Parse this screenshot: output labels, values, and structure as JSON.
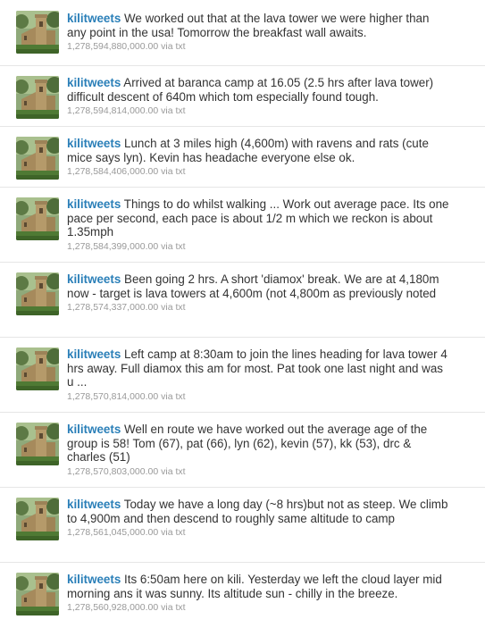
{
  "feed": {
    "tweets": [
      {
        "username": "kilitweets",
        "text": "We worked out that at the lava tower we were higher than any point in the usa! Tomorrow the breakfast wall awaits.",
        "id": "1,278,594,880,000.00",
        "via": "via txt"
      },
      {
        "username": "kilitweets",
        "text": "Arrived at baranca camp at 16.05 (2.5 hrs after lava tower) difficult descent of 640m which tom especially found tough.",
        "id": "1,278,594,814,000.00",
        "via": "via txt"
      },
      {
        "username": "kilitweets",
        "text": "Lunch at 3 miles high (4,600m) with ravens and rats (cute mice says lyn). Kevin has headache everyone else ok.",
        "id": "1,278,584,406,000.00",
        "via": "via txt"
      },
      {
        "username": "kilitweets",
        "text": "Things to do whilst walking ... Work out average pace. Its one pace per second, each pace is about 1/2 m which we reckon is about 1.35mph",
        "id": "1,278,584,399,000.00",
        "via": "via txt"
      },
      {
        "username": "kilitweets",
        "text": "Been going 2 hrs. A short 'diamox' break. We are at 4,180m now - target is lava towers at 4,600m (not 4,800m as previously noted",
        "id": "1,278,574,337,000.00",
        "via": "via txt"
      },
      {
        "username": "kilitweets",
        "text": "Left camp at 8:30am to join the lines heading for lava tower 4 hrs away. Full diamox this am for most. Pat took one last night and was u ...",
        "id": "1,278,570,814,000.00",
        "via": "via txt"
      },
      {
        "username": "kilitweets",
        "text": "Well en route we have worked out the average age of the group is 58! Tom (67), pat (66), lyn (62), kevin (57), kk (53), drc & charles (51)",
        "id": "1,278,570,803,000.00",
        "via": "via txt"
      },
      {
        "username": "kilitweets",
        "text": "Today we have a long day (~8 hrs)but not as steep. We climb to 4,900m and then descend to roughly same altitude to camp",
        "id": "1,278,561,045,000.00",
        "via": "via txt"
      },
      {
        "username": "kilitweets",
        "text": "Its 6:50am here on kili. Yesterday we left the cloud layer mid morning ans it was sunny. Its altitude sun - chilly in the breeze.",
        "id": "1,278,560,928,000.00",
        "via": "via txt"
      }
    ]
  }
}
